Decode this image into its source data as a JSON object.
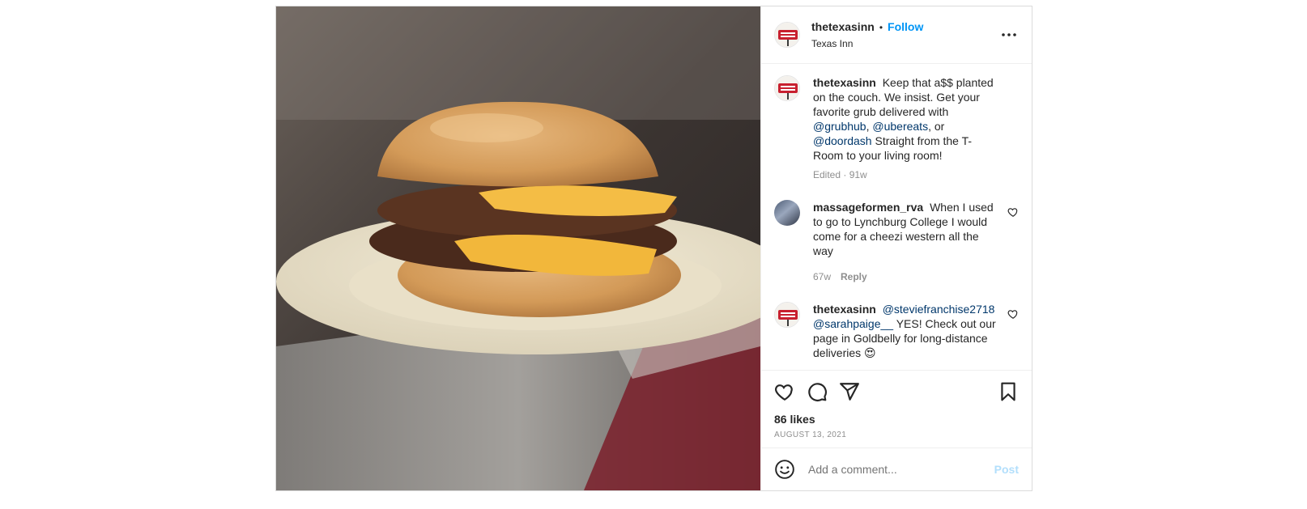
{
  "post": {
    "image_alt": "Double cheeseburger on a plate",
    "author": {
      "username": "thetexasinn",
      "follow_label": "Follow",
      "location": "Texas Inn"
    },
    "caption": {
      "username": "thetexasinn",
      "text_1": "Keep that a$$ planted on the couch. We insist. Get your favorite grub delivered with",
      "mention_1": "@grubhub",
      "sep_1": ", ",
      "mention_2": "@ubereats",
      "sep_2": ", or",
      "mention_3": "@doordash",
      "text_2": " Straight from the T-Room to your living room!",
      "meta": "Edited · 91w"
    },
    "comments": [
      {
        "username": "massageformen_rva",
        "text": "When I used to go to Lynchburg College I would come for a cheezi western all the way",
        "age": "67w",
        "reply_label": "Reply"
      },
      {
        "username": "thetexasinn",
        "mention_1": "@steviefranchise2718",
        "mention_2": "@sarahpaige__",
        "text": " YES! Check out our page in Goldbelly for long-distance deliveries 😍"
      }
    ],
    "likes": "86 likes",
    "date": "August 13, 2021",
    "add_comment": {
      "placeholder": "Add a comment...",
      "post_label": "Post"
    }
  }
}
